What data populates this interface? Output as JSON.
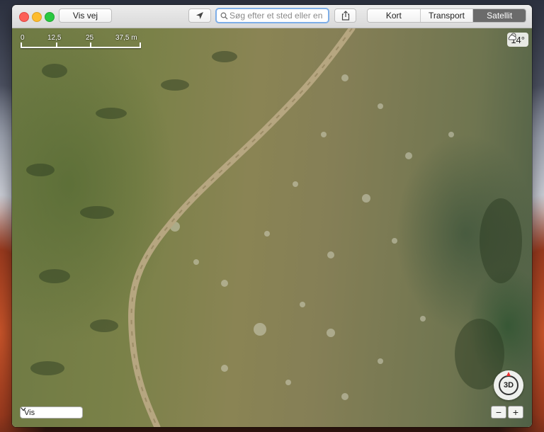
{
  "toolbar": {
    "route_label": "Vis vej",
    "search_placeholder": "Søg efter et sted eller en",
    "map_modes": [
      "Kort",
      "Transport",
      "Satellit"
    ],
    "active_mode": "Satellit"
  },
  "map": {
    "scale_labels": [
      "0",
      "12,5",
      "25",
      "37,5 m"
    ],
    "weather_icon": "cloud-sun-icon",
    "temperature": "14°",
    "view_select_label": "Vis",
    "compass_label": "3D",
    "zoom_out_label": "−",
    "zoom_in_label": "+"
  },
  "colors": {
    "active_segment": "#6b6b6b",
    "search_focus": "#7eaee8"
  }
}
